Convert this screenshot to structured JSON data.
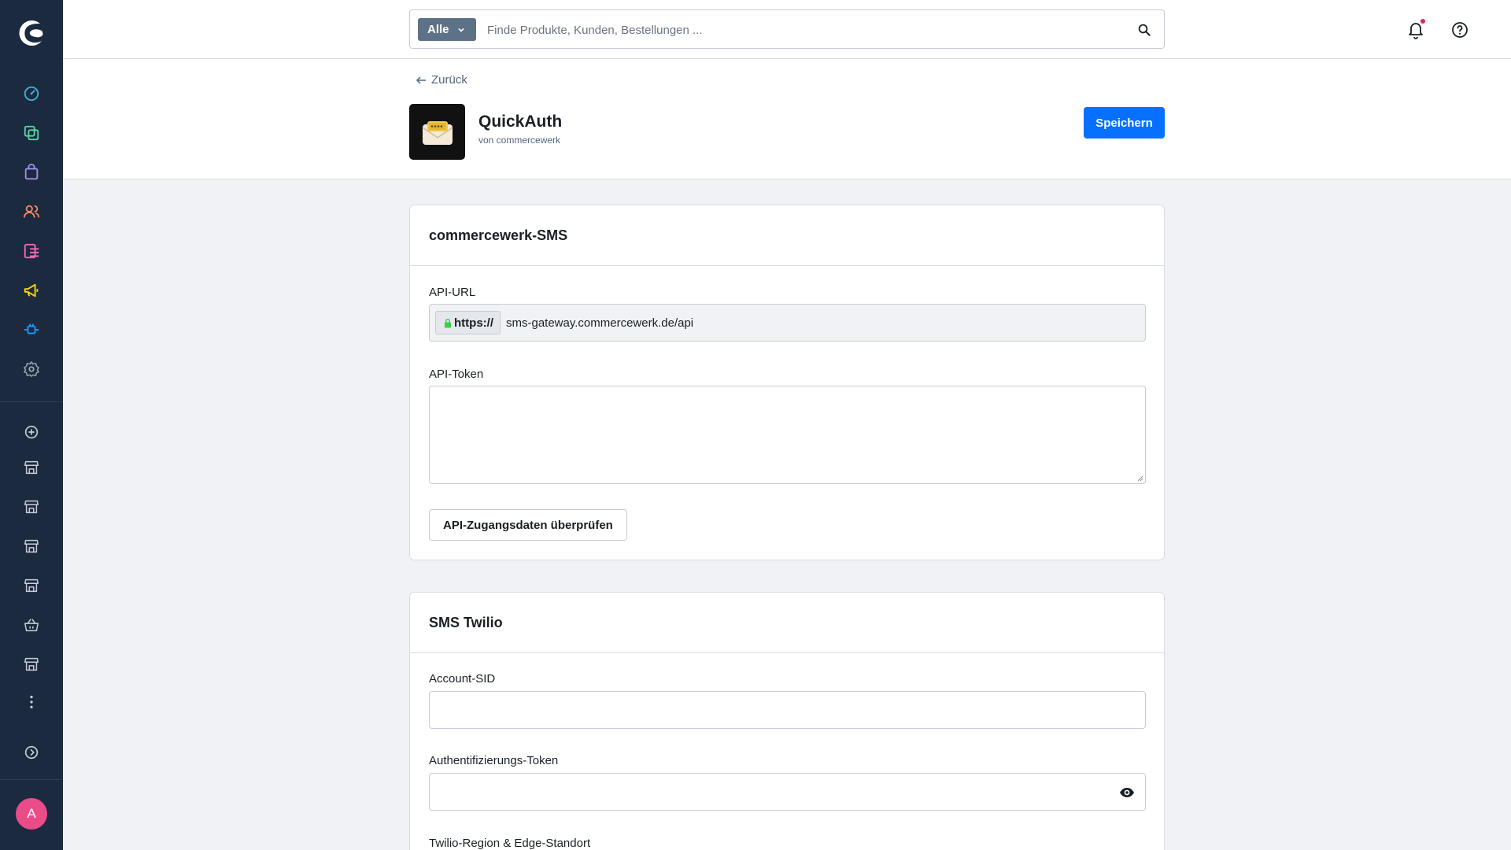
{
  "sidebar": {
    "logo_icon": "shopware-logo-icon",
    "nav_items": [
      {
        "name": "dashboard",
        "icon": "gauge-icon",
        "color": "#3bb4d8"
      },
      {
        "name": "catalogue",
        "icon": "catalogue-icon",
        "color": "#57d9a3"
      },
      {
        "name": "orders",
        "icon": "shopping-bag-icon",
        "color": "#a092f0"
      },
      {
        "name": "customers",
        "icon": "users-icon",
        "color": "#f88962"
      },
      {
        "name": "content",
        "icon": "content-icon",
        "color": "#ff68b4"
      },
      {
        "name": "marketing",
        "icon": "megaphone-icon",
        "color": "#ffd700"
      },
      {
        "name": "extensions",
        "icon": "plug-icon",
        "color": "#189eff"
      },
      {
        "name": "settings",
        "icon": "gear-icon",
        "color": "#9aa8b5"
      }
    ],
    "sales_channels": [
      {
        "icon": "plus-circle-icon"
      },
      {
        "icon": "storefront-icon"
      },
      {
        "icon": "storefront-icon"
      },
      {
        "icon": "storefront-icon"
      },
      {
        "icon": "storefront-icon"
      },
      {
        "icon": "basket-icon"
      },
      {
        "icon": "storefront-icon"
      }
    ],
    "more_icon": "more-vertical-icon",
    "collapse_icon": "chevron-circle-right-icon",
    "avatar_letter": "A",
    "avatar_color": "#ea4c89"
  },
  "topbar": {
    "search_type_label": "Alle",
    "search_placeholder": "Finde Produkte, Kunden, Bestellungen ...",
    "search_icon": "search-icon",
    "notifications_icon": "bell-icon",
    "help_icon": "question-circle-icon"
  },
  "header": {
    "back_label": "Zurück",
    "app_name": "QuickAuth",
    "app_vendor": "von commercewerk",
    "save_label": "Speichern"
  },
  "card_sms": {
    "title": "commercewerk-SMS",
    "api_url_label": "API-URL",
    "api_url_prefix": "https://",
    "api_url_value": "sms-gateway.commercewerk.de/api",
    "api_token_label": "API-Token",
    "api_token_value": "",
    "verify_button_label": "API-Zugangsdaten überprüfen"
  },
  "card_twilio": {
    "title": "SMS Twilio",
    "account_sid_label": "Account-SID",
    "account_sid_value": "",
    "auth_token_label": "Authentifizierungs-Token",
    "auth_token_value": "",
    "region_label": "Twilio-Region & Edge-Standort"
  },
  "colors": {
    "primary": "#0870ff",
    "sidebar_bg": "#1b2a3f"
  }
}
